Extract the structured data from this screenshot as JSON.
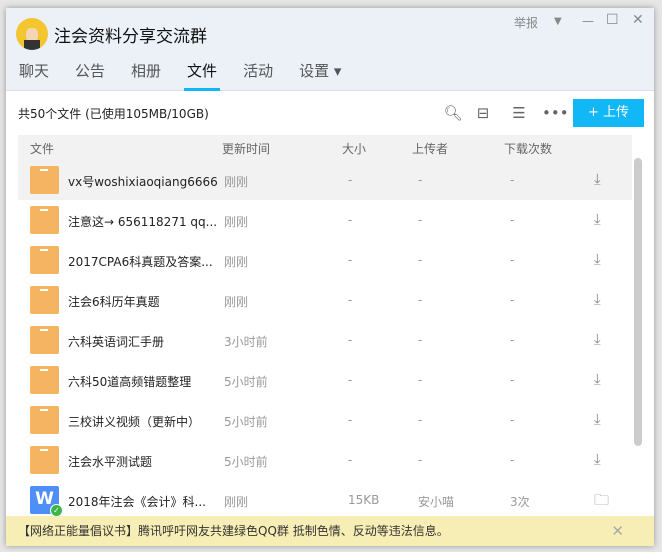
{
  "window": {
    "title": "注会资料分享交流群",
    "report": "举报",
    "controls": [
      "dropdown",
      "minimize",
      "maximize",
      "close"
    ]
  },
  "tabs": [
    {
      "label": "聊天"
    },
    {
      "label": "公告"
    },
    {
      "label": "相册"
    },
    {
      "label": "文件",
      "active": true
    },
    {
      "label": "活动"
    },
    {
      "label": "设置 ▾"
    }
  ],
  "toolbar": {
    "summary": "共50个文件 (已使用105MB/10GB)",
    "upload_label": "+ 上传"
  },
  "columns": [
    "文件",
    "更新时间",
    "大小",
    "上传者",
    "下载次数"
  ],
  "files": [
    {
      "name": "vx号woshixiaoqiang6666",
      "time": "刚刚",
      "size": "-",
      "uploader": "-",
      "downloads": "-",
      "type": "folder"
    },
    {
      "name": "注意这→ 656118271 qq...",
      "time": "刚刚",
      "size": "-",
      "uploader": "-",
      "downloads": "-",
      "type": "folder"
    },
    {
      "name": "2017CPA6科真题及答案...",
      "time": "刚刚",
      "size": "-",
      "uploader": "-",
      "downloads": "-",
      "type": "folder"
    },
    {
      "name": "注会6科历年真题",
      "time": "刚刚",
      "size": "-",
      "uploader": "-",
      "downloads": "-",
      "type": "folder"
    },
    {
      "name": "六科英语词汇手册",
      "time": "3小时前",
      "size": "-",
      "uploader": "-",
      "downloads": "-",
      "type": "folder"
    },
    {
      "name": "六科50道高频错题整理",
      "time": "5小时前",
      "size": "-",
      "uploader": "-",
      "downloads": "-",
      "type": "folder"
    },
    {
      "name": "三校讲义视频（更新中）",
      "time": "5小时前",
      "size": "-",
      "uploader": "-",
      "downloads": "-",
      "type": "folder"
    },
    {
      "name": "注会水平测试题",
      "time": "5小时前",
      "size": "-",
      "uploader": "-",
      "downloads": "-",
      "type": "folder"
    },
    {
      "name": "2018年注会《会计》科...",
      "time": "刚刚",
      "size": "15KB",
      "uploader": "安小喵",
      "downloads": "3次",
      "type": "word"
    }
  ],
  "banner": {
    "text": "【网络正能量倡议书】腾讯呼吁网友共建绿色QQ群 抵制色情、反动等违法信息。"
  },
  "colors": {
    "accent": "#12b7f5",
    "folder": "#f5b462",
    "banner": "#f7eeb5"
  }
}
